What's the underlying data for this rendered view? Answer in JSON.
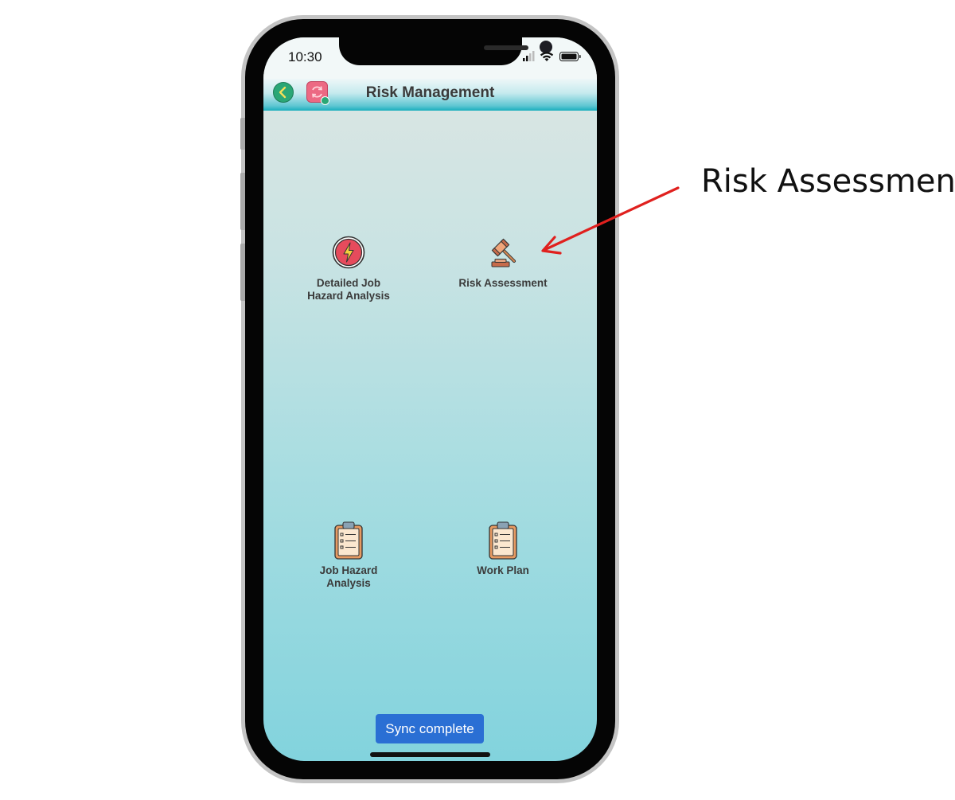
{
  "status_bar": {
    "time": "10:30"
  },
  "header": {
    "title": "Risk Management"
  },
  "menu": {
    "items": [
      {
        "label_line1": "Detailed Job",
        "label_line2": "Hazard Analysis",
        "icon": "lightning-icon"
      },
      {
        "label_line1": "Risk Assessment",
        "label_line2": "",
        "icon": "gavel-icon"
      },
      {
        "label_line1": "Job Hazard",
        "label_line2": "Analysis",
        "icon": "clipboard-icon"
      },
      {
        "label_line1": "Work Plan",
        "label_line2": "",
        "icon": "clipboard-icon"
      }
    ]
  },
  "toast": {
    "text": "Sync complete"
  },
  "annotation": {
    "text": "Risk Assessment",
    "color": "#e0201e"
  },
  "colors": {
    "toast": "#2a6fd4",
    "header_accent": "#1aaebd",
    "back_button": "#2aa776",
    "sync_button": "#ec6983"
  }
}
